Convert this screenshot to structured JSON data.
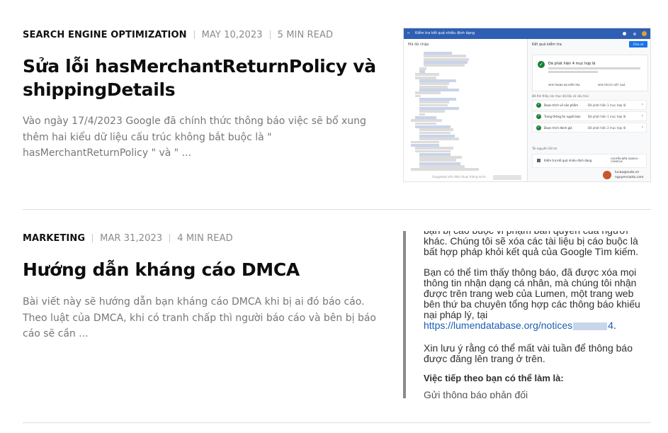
{
  "posts": [
    {
      "category": "SEARCH ENGINE OPTIMIZATION",
      "date": "MAY 10,2023",
      "read_time": "5 MIN READ",
      "title": "Sửa lỗi hasMerchantReturnPolicy và shippingDetails",
      "excerpt": "Vào ngày 17/4/2023 Google đã chính thức thông báo việc sẽ bổ xung thêm hai kiểu dữ liệu cấu trúc không bắt buộc là \" hasMerchantReturnPolicy \" và \" ...",
      "thumbnail": {
        "topbar_title": "Kiểm tra kết quả nhiều định dạng",
        "left_header": "Mã đã nhập",
        "right_header": "Kết quả kiểm tra",
        "share_label": "Chia sẻ",
        "result_title": "Đã phát hiện 4 mục hợp lệ",
        "result_buttons": [
          "XEM TRANG ĐÃ KIỂM TRA",
          "XEM TRƯỚC KẾT QUẢ"
        ],
        "detected_label": "Đã tìm thấy các mục dữ liệu có cấu trúc",
        "rows": [
          {
            "name": "Đoạn trích về sản phẩm",
            "status": "Đã phát hiện 1 mục hợp lệ"
          },
          {
            "name": "Trang thông tin người bán",
            "status": "Đã phát hiện 1 mục hợp lệ"
          },
          {
            "name": "Đoạn trích đánh giá",
            "status": "Đã phát hiện 2 mục hợp lệ"
          }
        ],
        "tools_label": "Tài nguyên hỗ trợ",
        "tool_text": "Kiểm tra kết quả nhiều định dạng",
        "tool_button": "CHUYỂN ĐẾN SEARCH CONSOLE",
        "user_email": "lucao@sudo.vn",
        "user_name": "nguyencaotu.com",
        "footer_text": "Googlebot trên điện thoại thông minh"
      }
    },
    {
      "category": "MARKETING",
      "date": "MAR 31,2023",
      "read_time": "4 MIN READ",
      "title": "Hướng dẫn kháng cáo DMCA",
      "excerpt": "Bài viết này sẽ hướng dẫn bạn kháng cáo DMCA khi bị ai đó báo cáo. Theo luật của DMCA, khi có tranh chấp thì người báo cáo và bên bị báo cáo sẽ cần ...",
      "thumbnail": {
        "para_1": "bạn bị cáo buộc vi phạm bản quyền của người khác. Chúng tôi sẽ xóa các tài liệu bị cáo buộc là bất hợp pháp khỏi kết quả của Google Tìm kiếm.",
        "para_2": "Bạn có thể tìm thấy thông báo, đã được xóa mọi thông tin nhận dạng cá nhân, mà chúng tôi nhận được trên trang web của Lumen, một trang web bên thứ ba chuyên tổng hợp các thông báo khiếu nại pháp lý, tại",
        "link_prefix": "https://lumendatabase.org/notices",
        "link_suffix": "4",
        "para_3": "Xin lưu ý rằng có thể mất vài tuần để thông báo được đăng lên trang ở trên.",
        "heading": "Việc tiếp theo bạn có thể làm là:",
        "para_4": "Gửi thông báo phản đối"
      }
    }
  ],
  "colors": {
    "category": "#111111",
    "meta": "#8b8b8b",
    "title": "#0d0d0d",
    "excerpt": "#777777",
    "divider": "#dcdcdc",
    "link": "#1a5fb4"
  }
}
